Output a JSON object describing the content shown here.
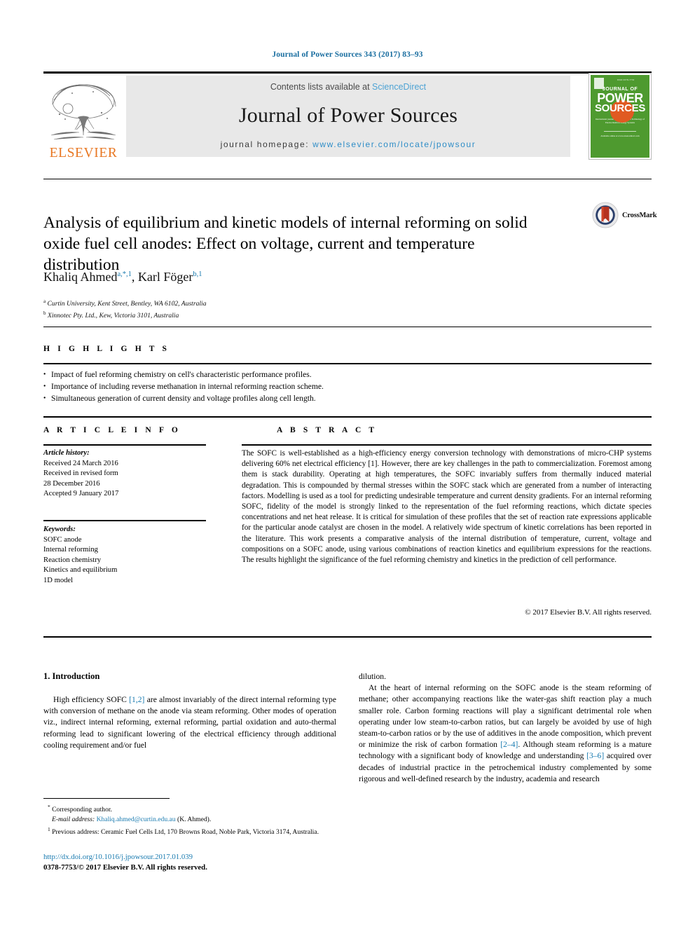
{
  "running_head": "Journal of Power Sources 343 (2017) 83–93",
  "masthead": {
    "elsevier_wordmark": "ELSEVIER",
    "contents_prefix": "Contents lists available at ",
    "sciencedirect": "ScienceDirect",
    "journal_name": "Journal of Power Sources",
    "homepage_prefix": "journal homepage: ",
    "homepage_url": "www.elsevier.com/locate/jpowsour",
    "cover": {
      "journal_of": "JOURNAL OF",
      "power": "POWER",
      "sources": "SOURCES",
      "subtitle": "International journal on the Science and Technology of Electrochemical Energy Systems",
      "footer": "Available online at www.sciencedirect.com"
    }
  },
  "article": {
    "title": "Analysis of equilibrium and kinetic models of internal reforming on solid oxide fuel cell anodes: Effect on voltage, current and temperature distribution",
    "crossmark_label": "CrossMark",
    "authors_plain": "Khaliq Ahmed a,*,1, Karl Föger b,1",
    "authors": [
      {
        "name": "Khaliq Ahmed",
        "marks": "a,*,1"
      },
      {
        "name": "Karl Föger",
        "marks": "b,1"
      }
    ],
    "affiliations": [
      {
        "mark": "a",
        "text": "Curtin University, Kent Street, Bentley, WA 6102, Australia"
      },
      {
        "mark": "b",
        "text": "Xinnotec Pty. Ltd., Kew, Victoria 3101, Australia"
      }
    ]
  },
  "highlights": {
    "heading": "H I G H L I G H T S",
    "items": [
      "Impact of fuel reforming chemistry on cell's characteristic performance profiles.",
      "Importance of including reverse methanation in internal reforming reaction scheme.",
      "Simultaneous generation of current density and voltage profiles along cell length."
    ]
  },
  "article_info": {
    "heading": "A R T I C L E   I N F O",
    "history_label": "Article history:",
    "history": [
      "Received 24 March 2016",
      "Received in revised form",
      "28 December 2016",
      "Accepted 9 January 2017"
    ],
    "keywords_label": "Keywords:",
    "keywords": [
      "SOFC anode",
      "Internal reforming",
      "Reaction chemistry",
      "Kinetics and equilibrium",
      "1D model"
    ]
  },
  "abstract": {
    "heading": "A B S T R A C T",
    "text": "The SOFC is well-established as a high-efficiency energy conversion technology with demonstrations of micro-CHP systems delivering 60% net electrical efficiency [1]. However, there are key challenges in the path to commercialization. Foremost among them is stack durability. Operating at high temperatures, the SOFC invariably suffers from thermally induced material degradation. This is compounded by thermal stresses within the SOFC stack which are generated from a number of interacting factors. Modelling is used as a tool for predicting undesirable temperature and current density gradients. For an internal reforming SOFC, fidelity of the model is strongly linked to the representation of the fuel reforming reactions, which dictate species concentrations and net heat release. It is critical for simulation of these profiles that the set of reaction rate expressions applicable for the particular anode catalyst are chosen in the model. A relatively wide spectrum of kinetic correlations has been reported in the literature. This work presents a comparative analysis of the internal distribution of temperature, current, voltage and compositions on a SOFC anode, using various combinations of reaction kinetics and equilibrium expressions for the reactions. The results highlight the significance of the fuel reforming chemistry and kinetics in the prediction of cell performance.",
    "copyright": "© 2017 Elsevier B.V. All rights reserved."
  },
  "body": {
    "section_heading": "1. Introduction",
    "left_paragraph_1_a": "High efficiency SOFC ",
    "left_paragraph_1_ref": "[1,2]",
    "left_paragraph_1_b": " are almost invariably of the direct internal reforming type with conversion of methane on the anode via steam reforming. Other modes of operation viz., indirect internal reforming, external reforming, partial oxidation and auto-thermal reforming lead to significant lowering of the electrical efficiency through additional cooling requirement and/or fuel",
    "right_orphan": "dilution.",
    "right_paragraph_a": "At the heart of internal reforming on the SOFC anode is the steam reforming of methane; other accompanying reactions like the water-gas shift reaction play a much smaller role. Carbon forming reactions will play a significant detrimental role when operating under low steam-to-carbon ratios, but can largely be avoided by use of high steam-to-carbon ratios or by the use of additives in the anode composition, which prevent or minimize the risk of carbon formation ",
    "right_paragraph_ref1": "[2–4]",
    "right_paragraph_b": ". Although steam reforming is a mature technology with a significant body of knowledge and understanding ",
    "right_paragraph_ref2": "[3–6]",
    "right_paragraph_c": " acquired over decades of industrial practice in the petrochemical industry complemented by some rigorous and well-defined research by the industry, academia and research"
  },
  "footnotes": {
    "corresponding_marker": "*",
    "corresponding_text": "Corresponding author.",
    "email_label": "E-mail address:",
    "email": "Khaliq.ahmed@curtin.edu.au",
    "email_suffix": "(K. Ahmed).",
    "prev_marker": "1",
    "prev_address": "Previous address: Ceramic Fuel Cells Ltd, 170 Browns Road, Noble Park, Victoria 3174, Australia."
  },
  "footer": {
    "doi": "http://dx.doi.org/10.1016/j.jpowsour.2017.01.039",
    "issn_line": "0378-7753/© 2017 Elsevier B.V. All rights reserved."
  },
  "colors": {
    "link_blue": "#1a7bb0",
    "sciencedirect_blue": "#4ea3d4",
    "elsevier_orange": "#E87722",
    "cover_green": "#4e9a2f",
    "masthead_grey": "#e8e8e8"
  }
}
